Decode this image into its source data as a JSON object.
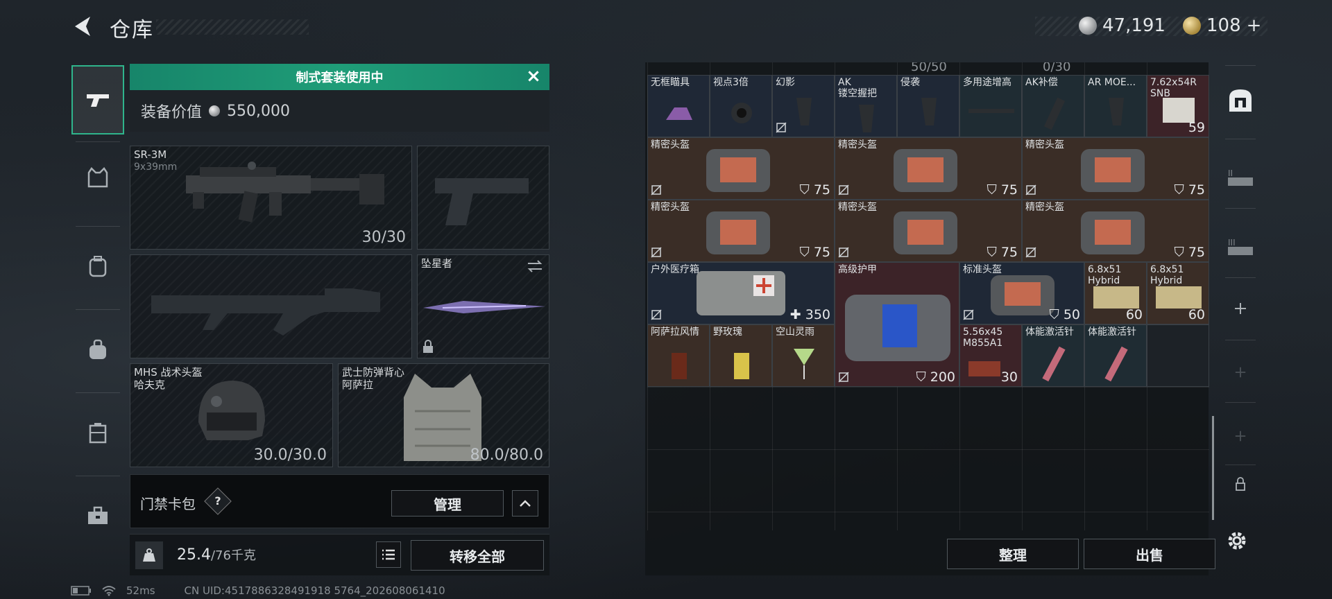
{
  "header": {
    "title": "仓库",
    "silver_amount": "47,191",
    "gold_amount": "108",
    "gold_add": "+"
  },
  "left_nav": [
    "weapons",
    "vest",
    "backpack",
    "bag",
    "container",
    "toolbox"
  ],
  "loadout": {
    "banner": "制式套装使用中",
    "value_label": "装备价值",
    "value": "550,000",
    "primary": {
      "name": "SR-3M",
      "caliber": "9x39mm",
      "ammo": "30/30"
    },
    "melee": {
      "name": "坠星者"
    },
    "helmet": {
      "name": "MHS 战术头盔",
      "sub": "哈夫克",
      "durability": "30.0/30.0"
    },
    "armor": {
      "name": "武士防弹背心",
      "sub": "阿萨拉",
      "durability": "80.0/80.0"
    },
    "card_label": "门禁卡包",
    "help": "?",
    "manage": "管理",
    "weight": "25.4",
    "weight_max": "/76千克",
    "transfer_all": "转移全部"
  },
  "status": {
    "ping": "52ms",
    "uid": "CN UID:4517886328491918 5764_202608061410"
  },
  "stash": {
    "peek": [
      "50/50",
      "0/30"
    ],
    "row1": [
      {
        "name": "无框瞄具"
      },
      {
        "name": "视点3倍"
      },
      {
        "name": "幻影"
      },
      {
        "name": "AK\n镂空握把"
      },
      {
        "name": "侵袭"
      },
      {
        "name": "多用途增高"
      },
      {
        "name": "AK补偿"
      },
      {
        "name": "AR MOE..."
      },
      {
        "name": "7.62x54R\nSNB",
        "qty": "59"
      }
    ],
    "helmets": [
      {
        "name": "精密头盔",
        "qty": "75"
      },
      {
        "name": "精密头盔",
        "qty": "75"
      },
      {
        "name": "精密头盔",
        "qty": "75"
      },
      {
        "name": "精密头盔",
        "qty": "75"
      },
      {
        "name": "精密头盔",
        "qty": "75"
      },
      {
        "name": "精密头盔",
        "qty": "75"
      }
    ],
    "medkit": {
      "name": "户外医疗箱",
      "qty": "350"
    },
    "high_armor": {
      "name": "高级护甲",
      "qty": "200"
    },
    "std_helmet": {
      "name": "标准头盔",
      "qty": "50"
    },
    "ammo1": {
      "name": "6.8x51\nHybrid",
      "qty": "60"
    },
    "ammo2": {
      "name": "6.8x51\nHybrid",
      "qty": "60"
    },
    "drink1": {
      "name": "阿萨拉风情"
    },
    "drink2": {
      "name": "野玫瑰"
    },
    "drink3": {
      "name": "空山灵雨"
    },
    "ammo3": {
      "name": "5.56x45\nM855A1",
      "qty": "30"
    },
    "stim1": {
      "name": "体能激活针"
    },
    "stim2": {
      "name": "体能激活针"
    },
    "sort": "整理",
    "sell": "出售"
  },
  "right_nav": [
    "safe-box",
    "II",
    "III",
    "+",
    "+",
    "+"
  ],
  "colors": {
    "accent": "#1f9d78",
    "panel": "#121417"
  }
}
